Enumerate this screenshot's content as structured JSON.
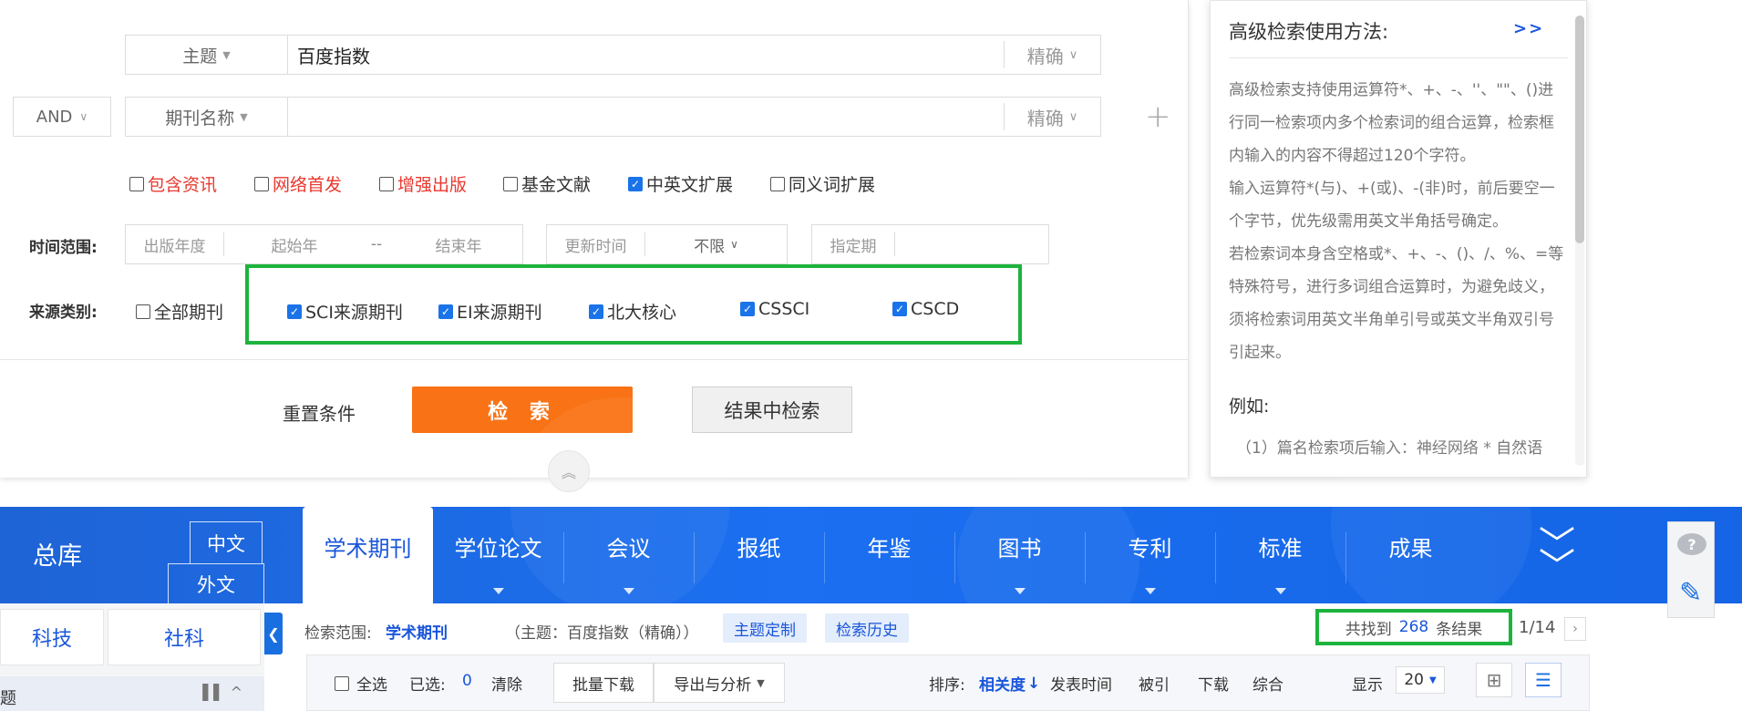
{
  "search": {
    "row1": {
      "field": "主题",
      "value": "百度指数",
      "match": "精确"
    },
    "row2": {
      "logic": "AND",
      "field": "期刊名称",
      "value": "",
      "match": "精确"
    },
    "options": [
      {
        "label": "包含资讯",
        "checked": false,
        "red": true
      },
      {
        "label": "网络首发",
        "checked": false,
        "red": true
      },
      {
        "label": "增强出版",
        "checked": false,
        "red": true
      },
      {
        "label": "基金文献",
        "checked": false,
        "red": false
      },
      {
        "label": "中英文扩展",
        "checked": true,
        "red": false
      },
      {
        "label": "同义词扩展",
        "checked": false,
        "red": false
      }
    ],
    "time": {
      "label": "时间范围:",
      "pub_year": "出版年度",
      "start_year": "起始年",
      "dash": "--",
      "end_year": "结束年",
      "update_time": "更新时间",
      "unlimited": "不限",
      "issue": "指定期"
    },
    "source": {
      "label": "来源类别:",
      "all": {
        "label": "全部期刊",
        "checked": false
      },
      "items": [
        {
          "label": "SCI来源期刊",
          "checked": true
        },
        {
          "label": "EI来源期刊",
          "checked": true
        },
        {
          "label": "北大核心",
          "checked": true
        },
        {
          "label": "CSSCI",
          "checked": true
        },
        {
          "label": "CSCD",
          "checked": true
        }
      ]
    },
    "buttons": {
      "reset": "重置条件",
      "search": "检 索",
      "in_result": "结果中检索"
    }
  },
  "help": {
    "title": "高级检索使用方法:",
    "more": ">>",
    "paragraphs": [
      "高级检索支持使用运算符*、+、-、''、\"\"、()进行同一检索项内多个检索词的组合运算，检索框内输入的内容不得超过120个字符。",
      "输入运算符*(与)、+(或)、-(非)时，前后要空一个字节，优先级需用英文半角括号确定。",
      "若检索词本身含空格或*、+、-、()、/、%、=等特殊符号，进行多词组合运算时，为避免歧义，须将检索词用英文半角单引号或英文半角双引号引起来。"
    ],
    "example_title": "例如:",
    "example_1": "（1）篇名检索项后输入：神经网络 * 自然语"
  },
  "nav": {
    "zongku": "总库",
    "lang_cn": "中文",
    "lang_en": "外文",
    "tabs": [
      {
        "label": "学术期刊",
        "active": true,
        "has_sub": false
      },
      {
        "label": "学位论文",
        "active": false,
        "has_sub": true
      },
      {
        "label": "会议",
        "active": false,
        "has_sub": true
      },
      {
        "label": "报纸",
        "active": false,
        "has_sub": false
      },
      {
        "label": "年鉴",
        "active": false,
        "has_sub": false
      },
      {
        "label": "图书",
        "active": false,
        "has_sub": true
      },
      {
        "label": "专利",
        "active": false,
        "has_sub": true
      },
      {
        "label": "标准",
        "active": false,
        "has_sub": true
      },
      {
        "label": "成果",
        "active": false,
        "has_sub": false
      }
    ]
  },
  "category": {
    "tech": "科技",
    "social": "社科",
    "sub_label": "题"
  },
  "results": {
    "scope_label": "检索范围:",
    "scope_value": "学术期刊",
    "query": "（主题：百度指数（精确））",
    "customize": "主题定制",
    "history": "检索历史",
    "count_prefix": "共找到",
    "count": "268",
    "count_suffix": "条结果",
    "page": "1/14"
  },
  "toolbar": {
    "select_all": "全选",
    "selected_label": "已选:",
    "selected_count": "0",
    "clear": "清除",
    "batch_download": "批量下载",
    "export": "导出与分析",
    "sort_label": "排序:",
    "sort_relevance": "相关度",
    "sort_date": "发表时间",
    "sort_cited": "被引",
    "sort_download": "下载",
    "sort_composite": "综合",
    "show_label": "显示",
    "show_value": "20"
  },
  "colors": {
    "nav_blue": "#1b6ff0",
    "search_orange": "#f97316",
    "highlight_green": "#1db33d",
    "link_blue": "#1a56db",
    "red_option": "#e8382f"
  }
}
